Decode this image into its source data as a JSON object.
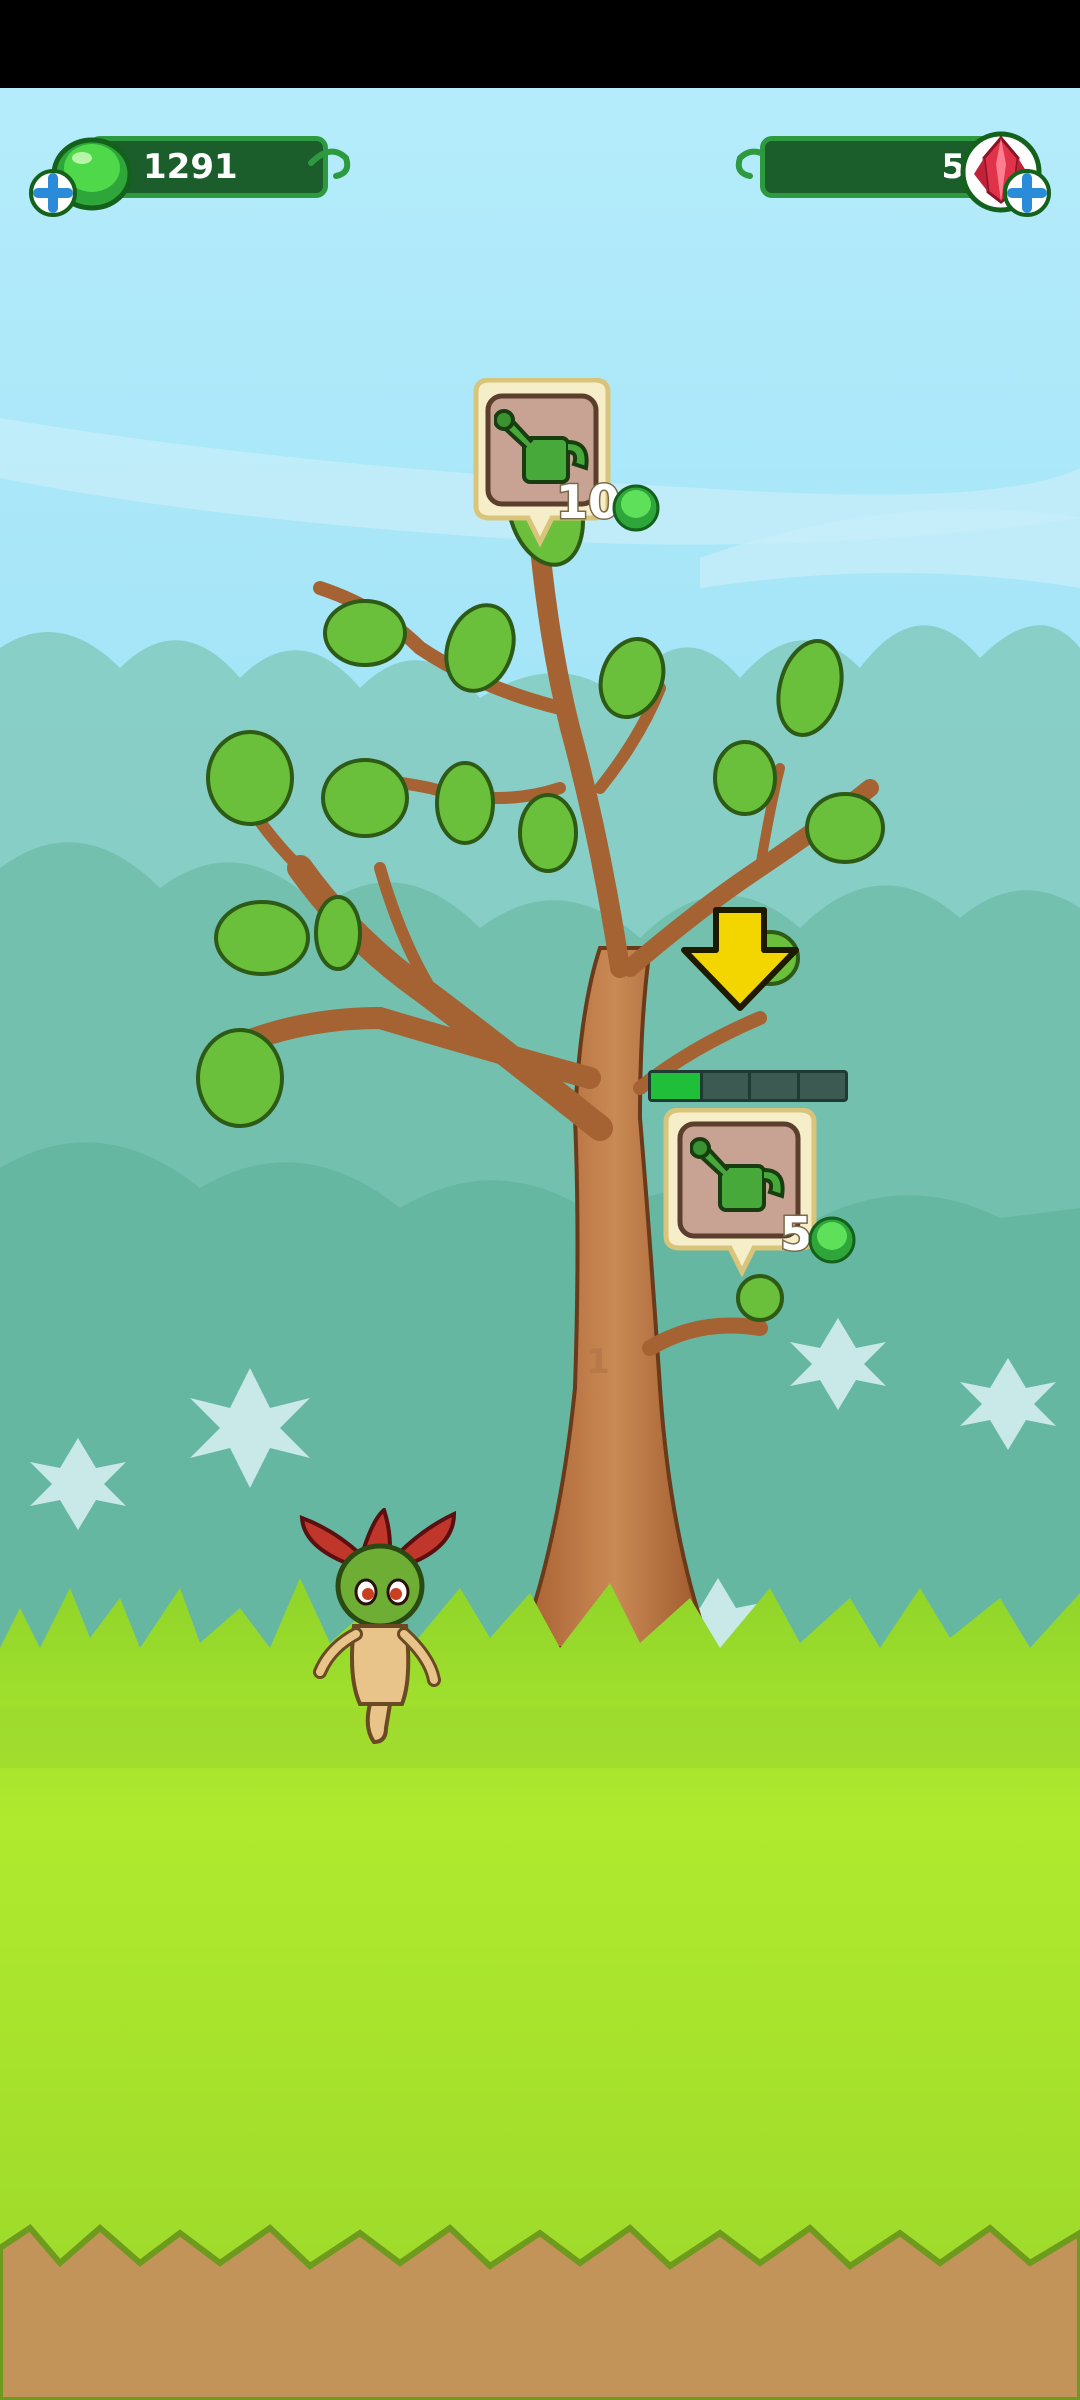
{
  "status_bar": {
    "visible": true
  },
  "hud": {
    "gems": {
      "value": "1291",
      "icon": "green-gem-icon",
      "add_icon": "plus-icon"
    },
    "crystals": {
      "value": "5",
      "icon": "red-crystal-icon",
      "add_icon": "plus-icon"
    }
  },
  "tree": {
    "level": "1",
    "upgrades": [
      {
        "icon": "watering-can-icon",
        "cost": "10",
        "currency_icon": "green-gem-icon"
      },
      {
        "icon": "watering-can-icon",
        "cost": "5",
        "currency_icon": "green-gem-icon"
      }
    ],
    "growth_progress": 0.25,
    "growth_segments": 4,
    "hint_arrow": "down-arrow-icon"
  },
  "character": {
    "name_icon": "leaf-sprite-character"
  },
  "colors": {
    "sky": "#a9e6f7",
    "grass": "#a3e02e",
    "dirt": "#c2935b",
    "hud_fill": "#1b5e2b",
    "progress_fill": "#1fbf3a",
    "arrow": "#f3d600"
  }
}
